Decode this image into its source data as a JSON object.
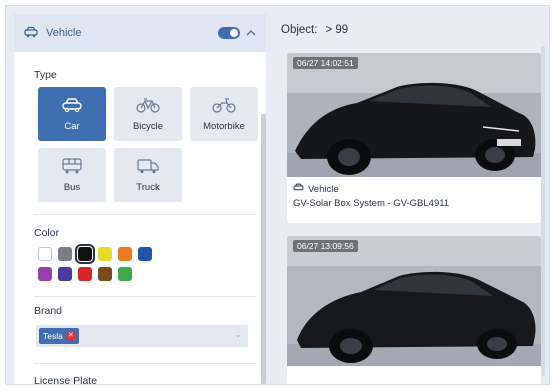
{
  "filter_panel": {
    "header": {
      "icon": "car-icon",
      "title": "Vehicle",
      "toggle_on": true,
      "chevron": "chevron-up-icon"
    },
    "type": {
      "label": "Type",
      "options": [
        {
          "label": "Car",
          "icon": "car-icon",
          "selected": true
        },
        {
          "label": "Bicycle",
          "icon": "bicycle-icon",
          "selected": false
        },
        {
          "label": "Motorbike",
          "icon": "motorbike-icon",
          "selected": false
        },
        {
          "label": "Bus",
          "icon": "bus-icon",
          "selected": false
        },
        {
          "label": "Truck",
          "icon": "truck-icon",
          "selected": false
        }
      ]
    },
    "color": {
      "label": "Color",
      "swatches": [
        {
          "name": "white",
          "hex": "#ffffff",
          "selected": false
        },
        {
          "name": "gray",
          "hex": "#7a7e86",
          "selected": false
        },
        {
          "name": "black",
          "hex": "#111111",
          "selected": true
        },
        {
          "name": "yellow",
          "hex": "#e2dd2a",
          "selected": false
        },
        {
          "name": "orange",
          "hex": "#ec7c22",
          "selected": false
        },
        {
          "name": "blue",
          "hex": "#1f56a6",
          "selected": false
        },
        {
          "name": "purple",
          "hex": "#9a3fb0",
          "selected": false
        },
        {
          "name": "indigo",
          "hex": "#4b3aa0",
          "selected": false
        },
        {
          "name": "red",
          "hex": "#d8252c",
          "selected": false
        },
        {
          "name": "brown",
          "hex": "#7a4a1e",
          "selected": false
        },
        {
          "name": "green",
          "hex": "#3fa84a",
          "selected": false
        }
      ]
    },
    "brand": {
      "label": "Brand",
      "chips": [
        {
          "label": "Tesla"
        }
      ]
    },
    "license_plate": {
      "label": "License Plate"
    }
  },
  "results": {
    "label": "Object:",
    "count": "> 99",
    "cards": [
      {
        "timestamp": "06/27 14:02:51",
        "type": "Vehicle",
        "source": "GV-Solar Box System - GV-GBL4911"
      },
      {
        "timestamp": "06/27 13:09:56",
        "type": "",
        "source": ""
      }
    ]
  },
  "colors": {
    "accent": "#3f6fb0",
    "header_bg": "#dfe6f2",
    "tile_bg": "#e4e8ef",
    "page_bg": "#e9ecf2"
  }
}
